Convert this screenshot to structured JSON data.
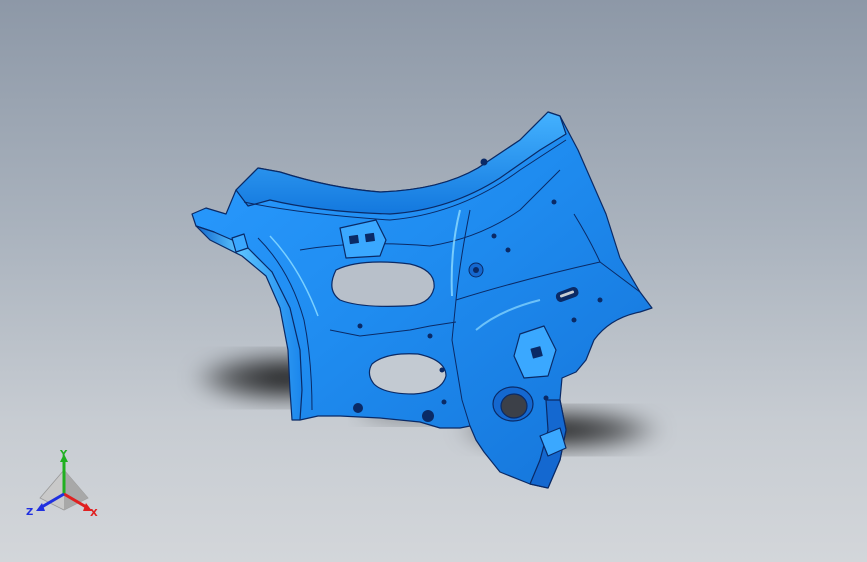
{
  "viewport": {
    "background_top": "#8d98a7",
    "background_bottom": "#d3d6da",
    "part_color": "#1f8cf0",
    "part_highlight": "#5fc0ff",
    "part_shadow": "#0b5cc2"
  },
  "triad": {
    "x_label": "X",
    "y_label": "Y",
    "z_label": "Z",
    "x_color": "#e02020",
    "y_color": "#20b020",
    "z_color": "#2030e0"
  }
}
